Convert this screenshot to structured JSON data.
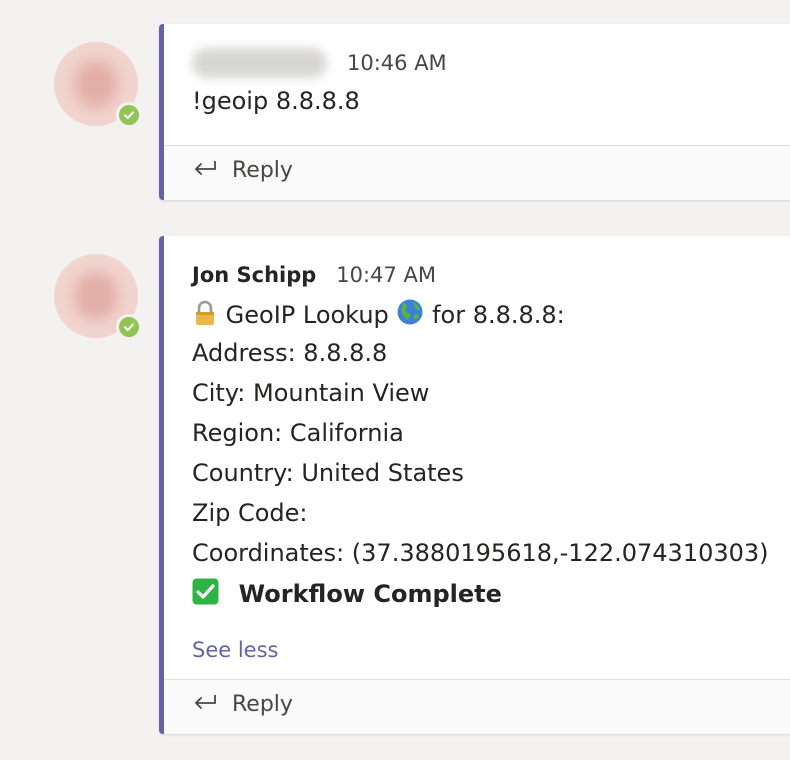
{
  "messages": [
    {
      "sender": "",
      "timestamp": "10:46 AM",
      "text": "!geoip 8.8.8.8",
      "reply_label": "Reply"
    },
    {
      "sender": "Jon Schipp",
      "timestamp": "10:47 AM",
      "lookup_title": "GeoIP Lookup",
      "lookup_suffix": "for 8.8.8.8:",
      "address": "Address: 8.8.8.8",
      "city": "City: Mountain View",
      "region": "Region: California",
      "country": "Country: United States",
      "zip": "Zip Code:",
      "coordinates": "Coordinates: (37.3880195618,-122.074310303)",
      "workflow_status": "Workflow Complete",
      "see_less_label": "See less",
      "reply_label": "Reply"
    }
  ],
  "icons": {
    "lock": "lock-icon",
    "globe": "globe-icon",
    "check": "check-mark-icon",
    "reply": "reply-arrow-icon",
    "presence": "presence-available-icon"
  },
  "colors": {
    "accent": "#6264a7",
    "presence": "#92c353",
    "check_box": "#2fb344",
    "background": "#f3f2f1"
  }
}
